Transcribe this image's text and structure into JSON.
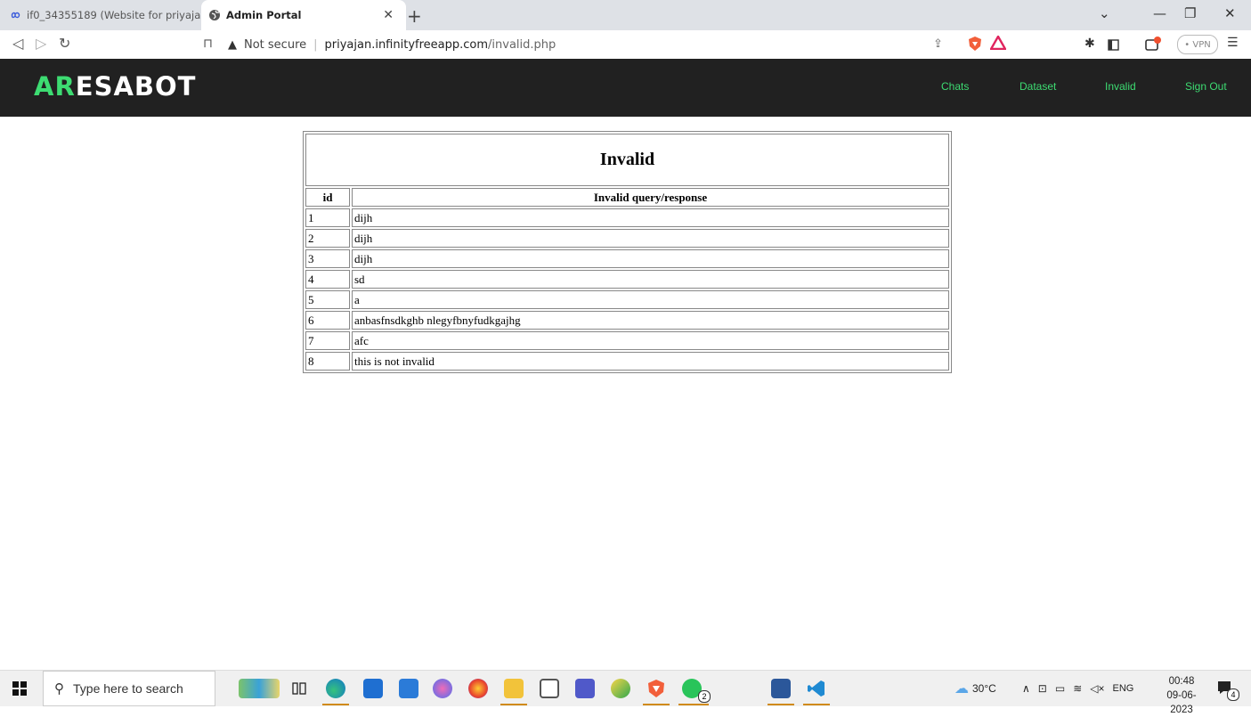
{
  "browser": {
    "tabs": [
      {
        "title": "if0_34355189 (Website for priyajan.infi",
        "active": false
      },
      {
        "title": "Admin Portal",
        "active": true
      }
    ],
    "address": {
      "security": "Not secure",
      "host": "priyajan.infinityfreeapp.com",
      "path": "/invalid.php"
    },
    "vpn_label": "• VPN"
  },
  "site": {
    "logo_accent": "AR",
    "logo_rest": "ESABOT",
    "nav": {
      "chats": "Chats",
      "dataset": "Dataset",
      "invalid": "Invalid",
      "signout": "Sign Out"
    },
    "colors": {
      "header_bg": "#212121",
      "accent": "#3ddc72"
    }
  },
  "table": {
    "title": "Invalid",
    "headers": {
      "id": "id",
      "query": "Invalid query/response"
    },
    "rows": [
      {
        "id": "1",
        "text": "dijh"
      },
      {
        "id": "2",
        "text": "dijh"
      },
      {
        "id": "3",
        "text": "dijh"
      },
      {
        "id": "4",
        "text": "sd"
      },
      {
        "id": "5",
        "text": "a"
      },
      {
        "id": "6",
        "text": "anbasfnsdkghb nlegyfbnyfudkgajhg"
      },
      {
        "id": "7",
        "text": "afc"
      },
      {
        "id": "8",
        "text": "this is not invalid"
      }
    ]
  },
  "taskbar": {
    "search_placeholder": "Type here to search",
    "weather": "30°C",
    "language": "ENG",
    "time": "00:48",
    "date": "09-06-2023",
    "whatsapp_badge": "2",
    "notifications": "4"
  }
}
